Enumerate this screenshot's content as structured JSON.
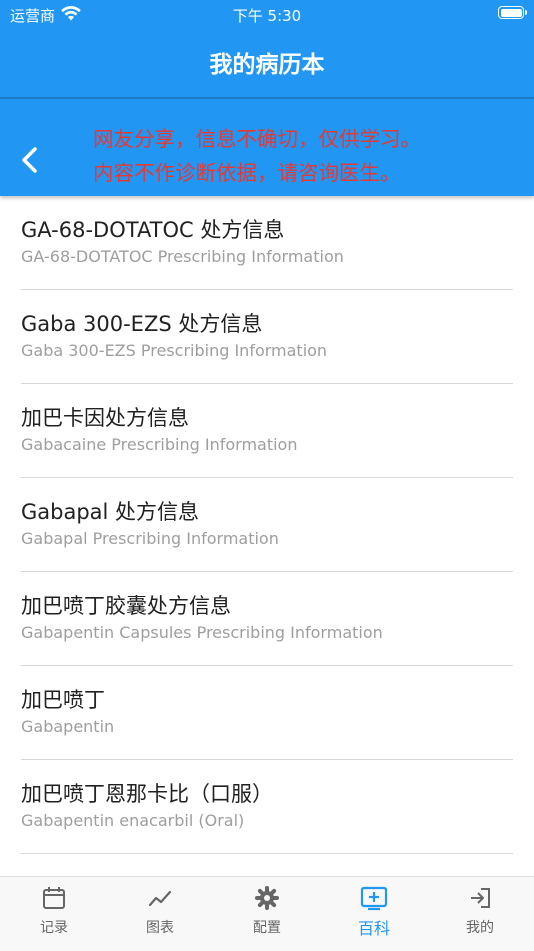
{
  "status": {
    "carrier": "运营商",
    "time": "下午 5:30"
  },
  "appbar": {
    "title": "我的病历本"
  },
  "disclaimer": {
    "line1": "网友分享，信息不确切，仅供学习。",
    "line2": "内容不作诊断依据，请咨询医生。",
    "color": "#e53935"
  },
  "colors": {
    "primary": "#2196f3"
  },
  "items": [
    {
      "title": "GA-68-DOTATOC 处方信息",
      "subtitle": "GA-68-DOTATOC Prescribing Information"
    },
    {
      "title": "Gaba 300-EZS 处方信息",
      "subtitle": "Gaba 300-EZS Prescribing Information"
    },
    {
      "title": "加巴卡因处方信息",
      "subtitle": "Gabacaine Prescribing Information"
    },
    {
      "title": "Gabapal 处方信息",
      "subtitle": "Gabapal Prescribing Information"
    },
    {
      "title": "加巴喷丁胶囊处方信息",
      "subtitle": "Gabapentin Capsules Prescribing Information"
    },
    {
      "title": "加巴喷丁",
      "subtitle": "Gabapentin"
    },
    {
      "title": "加巴喷丁恩那卡比（口服）",
      "subtitle": "Gabapentin enacarbil (Oral)"
    }
  ],
  "tabs": [
    {
      "label": "记录",
      "icon": "calendar-icon"
    },
    {
      "label": "图表",
      "icon": "chart-line-icon"
    },
    {
      "label": "配置",
      "icon": "gear-icon"
    },
    {
      "label": "百科",
      "icon": "add-box-icon",
      "active": true
    },
    {
      "label": "我的",
      "icon": "login-icon"
    }
  ]
}
